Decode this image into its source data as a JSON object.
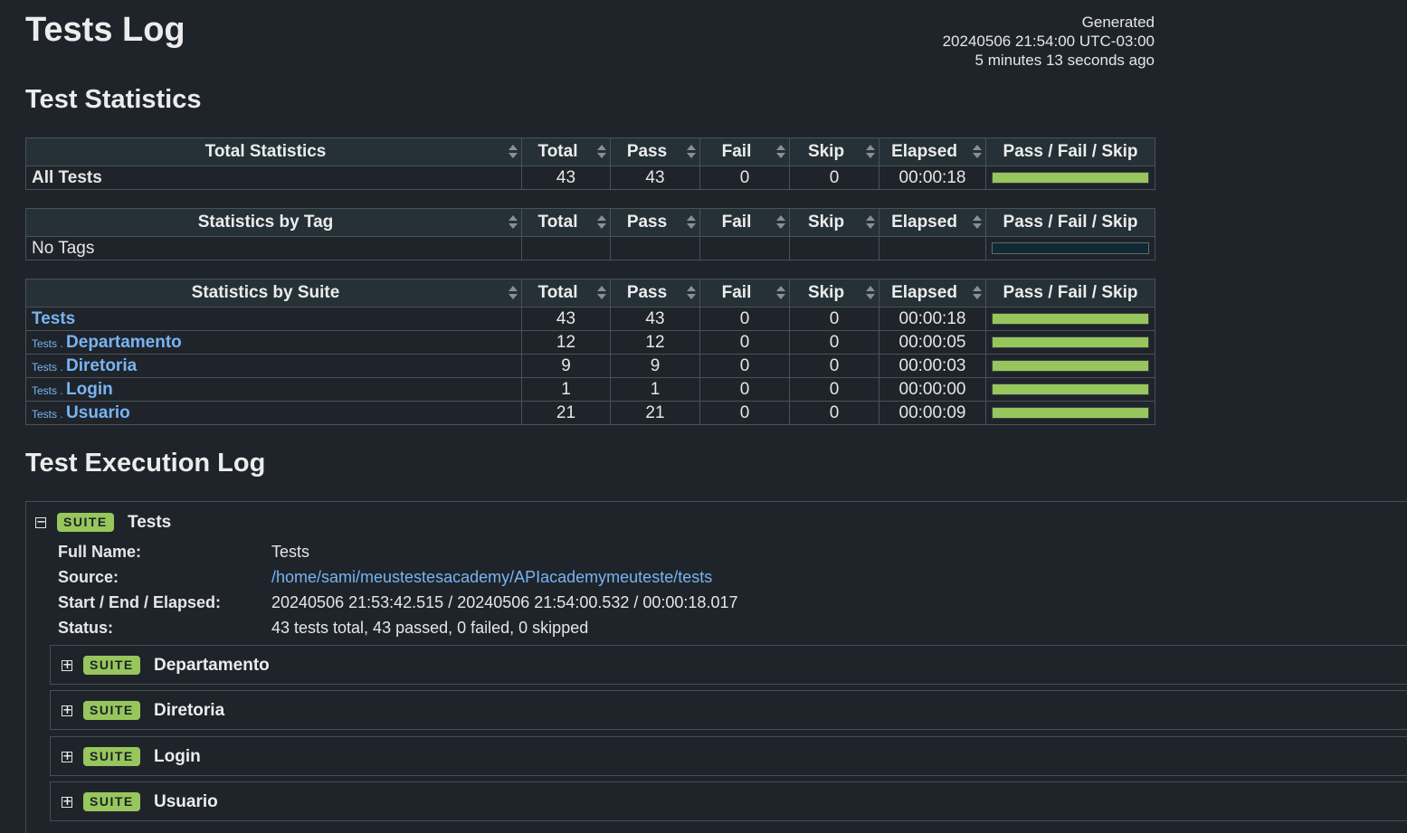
{
  "header": {
    "title": "Tests Log",
    "generated_label": "Generated",
    "generated_time": "20240506 21:54:00 UTC-03:00",
    "generated_ago": "5 minutes 13 seconds ago"
  },
  "sections": {
    "statistics": "Test Statistics",
    "execution_log": "Test Execution Log"
  },
  "columns": [
    "Total",
    "Pass",
    "Fail",
    "Skip",
    "Elapsed",
    "Pass / Fail / Skip"
  ],
  "total_statistics": {
    "heading": "Total Statistics",
    "rows": [
      {
        "name": "All Tests",
        "total": "43",
        "pass": "43",
        "fail": "0",
        "skip": "0",
        "elapsed": "00:00:18",
        "pass_fraction": 1.0
      }
    ]
  },
  "tag_statistics": {
    "heading": "Statistics by Tag",
    "rows": [
      {
        "name": "No Tags",
        "total": "",
        "pass": "",
        "fail": "",
        "skip": "",
        "elapsed": "",
        "pass_fraction": 0
      }
    ]
  },
  "suite_statistics": {
    "heading": "Statistics by Suite",
    "rows": [
      {
        "parent": "",
        "name": "Tests",
        "total": "43",
        "pass": "43",
        "fail": "0",
        "skip": "0",
        "elapsed": "00:00:18",
        "pass_fraction": 1.0
      },
      {
        "parent": "Tests",
        "name": "Departamento",
        "total": "12",
        "pass": "12",
        "fail": "0",
        "skip": "0",
        "elapsed": "00:00:05",
        "pass_fraction": 1.0
      },
      {
        "parent": "Tests",
        "name": "Diretoria",
        "total": "9",
        "pass": "9",
        "fail": "0",
        "skip": "0",
        "elapsed": "00:00:03",
        "pass_fraction": 1.0
      },
      {
        "parent": "Tests",
        "name": "Login",
        "total": "1",
        "pass": "1",
        "fail": "0",
        "skip": "0",
        "elapsed": "00:00:00",
        "pass_fraction": 1.0
      },
      {
        "parent": "Tests",
        "name": "Usuario",
        "total": "21",
        "pass": "21",
        "fail": "0",
        "skip": "0",
        "elapsed": "00:00:09",
        "pass_fraction": 1.0
      }
    ]
  },
  "log": {
    "suite_badge": "SUITE",
    "root_suite": {
      "name": "Tests",
      "collapse_symbol": "−",
      "fields": {
        "full_name_label": "Full Name:",
        "full_name": "Tests",
        "source_label": "Source:",
        "source": "/home/sami/meustestesacademy/APIacademymeuteste/tests",
        "times_label": "Start / End / Elapsed:",
        "times": "20240506 21:53:42.515 / 20240506 21:54:00.532 / 00:00:18.017",
        "status_label": "Status:",
        "status": "43 tests total, 43 passed, 0 failed, 0 skipped"
      }
    },
    "expand_symbol": "+",
    "child_suites": [
      "Departamento",
      "Diretoria",
      "Login",
      "Usuario"
    ]
  },
  "colors": {
    "background": "#1f242b",
    "pass": "#97c65c",
    "link": "#78b4f2",
    "header_bg": "#253137"
  }
}
